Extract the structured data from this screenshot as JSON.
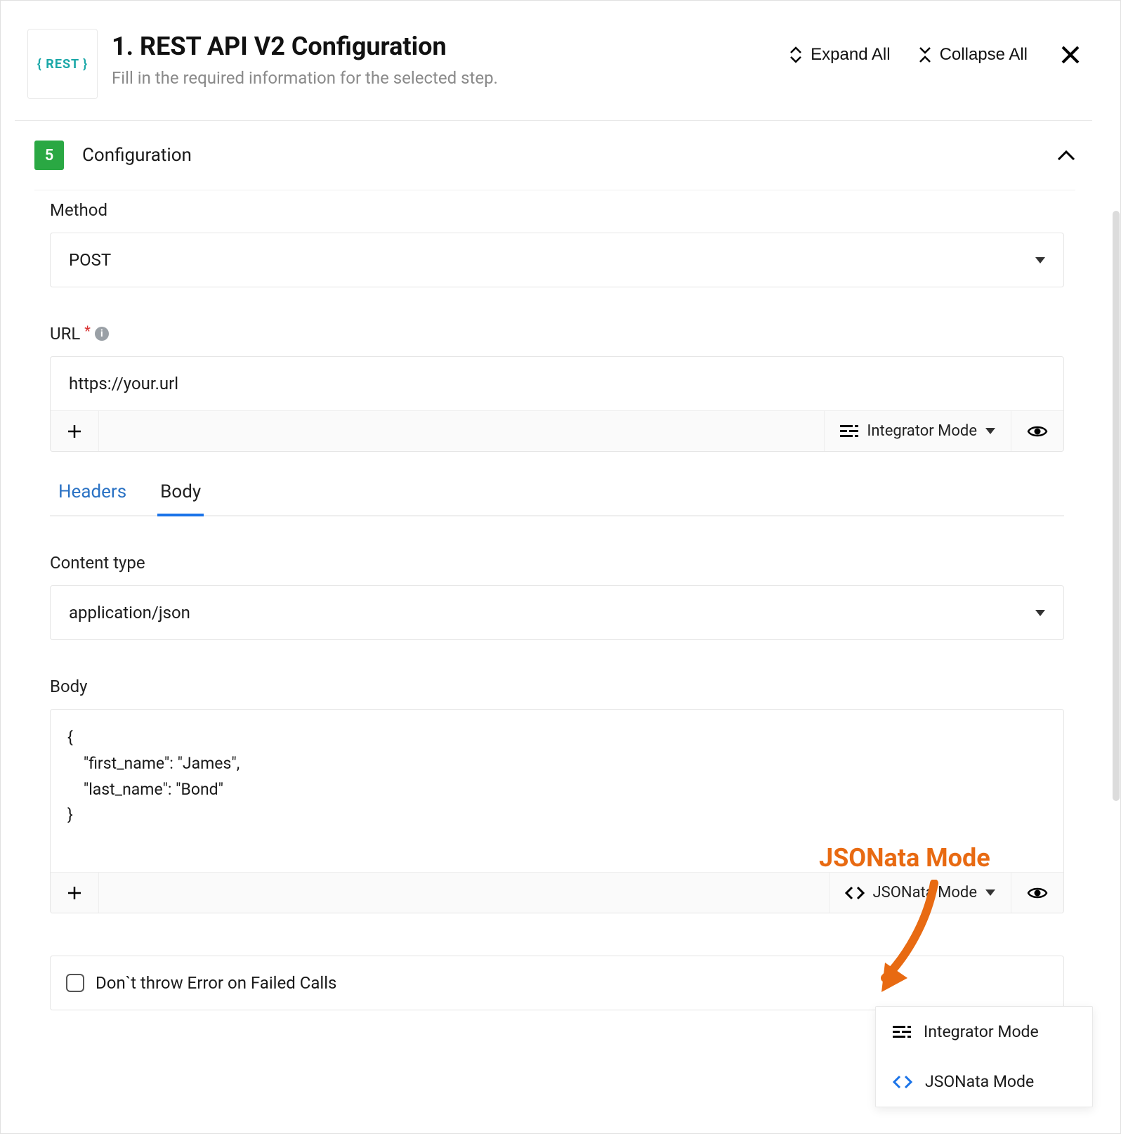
{
  "header": {
    "logo_text": "{ REST }",
    "title": "1. REST API V2 Configuration",
    "subtitle": "Fill in the required information for the selected step.",
    "expand_all": "Expand All",
    "collapse_all": "Collapse All"
  },
  "section": {
    "badge": "5",
    "title": "Configuration"
  },
  "method": {
    "label": "Method",
    "value": "POST"
  },
  "url": {
    "label": "URL",
    "value": "https://your.url",
    "mode_label": "Integrator Mode"
  },
  "tabs": {
    "headers": "Headers",
    "body": "Body"
  },
  "content_type": {
    "label": "Content type",
    "value": "application/json"
  },
  "body": {
    "label": "Body",
    "line1": "{",
    "line2": "    \"first_name\": \"James\",",
    "line3": "    \"last_name\": \"Bond\"",
    "line4": "}",
    "mode_label": "JSONata Mode"
  },
  "dropdown": {
    "item1": "Integrator Mode",
    "item2": "JSONata Mode"
  },
  "checkbox_label": "Don`t throw Error on Failed Calls",
  "annotation": "JSONata Mode"
}
